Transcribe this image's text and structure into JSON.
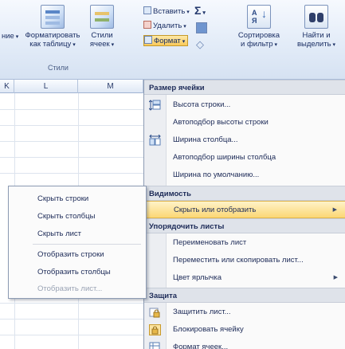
{
  "ribbon": {
    "partial_left_label": "ние",
    "format_as_table": "Форматировать как таблицу",
    "cell_styles": "Стили ячеек",
    "styles_group": "Стили",
    "insert": "Вставить",
    "delete": "Удалить",
    "format": "Формат",
    "sort_filter": "Сортировка и фильтр",
    "find_select": "Найти и выделить"
  },
  "sheet": {
    "columns": [
      "K",
      "L",
      "M"
    ]
  },
  "menu": {
    "cell_size_header": "Размер ячейки",
    "row_height": "Высота строки...",
    "autofit_row": "Автоподбор высоты строки",
    "column_width": "Ширина столбца...",
    "autofit_column": "Автоподбор ширины столбца",
    "default_width": "Ширина по умолчанию...",
    "visibility_header": "Видимость",
    "hide_unhide": "Скрыть или отобразить",
    "organize_header": "Упорядочить листы",
    "rename_sheet": "Переименовать лист",
    "move_copy_sheet": "Переместить или скопировать лист...",
    "tab_color": "Цвет ярлычка",
    "protection_header": "Защита",
    "protect_sheet": "Защитить лист...",
    "lock_cell": "Блокировать ячейку",
    "format_cells": "Формат ячеек..."
  },
  "submenu": {
    "hide_rows": "Скрыть строки",
    "hide_columns": "Скрыть столбцы",
    "hide_sheet": "Скрыть лист",
    "unhide_rows": "Отобразить строки",
    "unhide_columns": "Отобразить столбцы",
    "unhide_sheet": "Отобразить лист..."
  },
  "colors": {
    "highlight": "#fbd775",
    "menu_header_bg": "#dfe3ea",
    "ribbon_bg": "#e3ecf8"
  }
}
